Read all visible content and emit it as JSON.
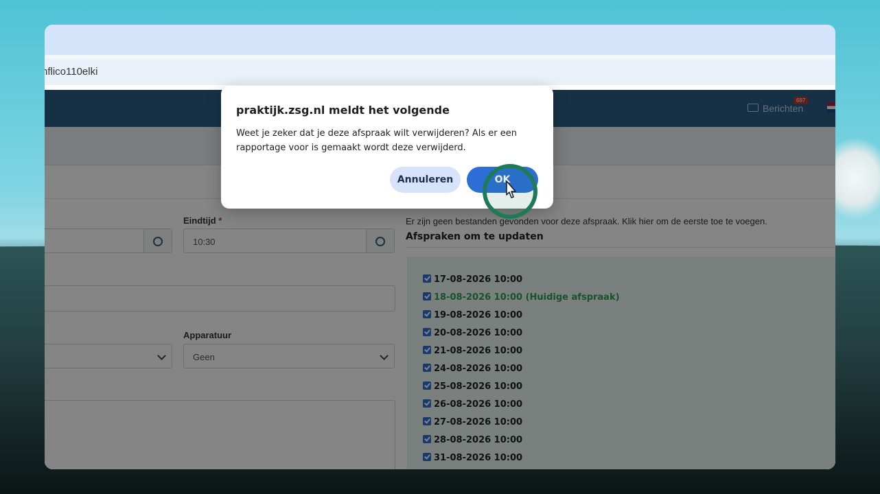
{
  "browser": {
    "url_fragment": "nflico110elki"
  },
  "navbar": {
    "messages_label": "Berichten",
    "messages_count": "697"
  },
  "form": {
    "end_time_label": "Eindtijd",
    "required_marker": "*",
    "end_time_value": "10:30",
    "equipment_label": "Apparatuur",
    "equipment_value": "Geen"
  },
  "files": {
    "empty_text": "Er zijn geen bestanden gevonden voor deze afspraak. Klik hier om de eerste toe te voegen."
  },
  "appointments": {
    "title": "Afspraken om te updaten",
    "items": [
      {
        "label": "17-08-2026 10:00",
        "checked": true,
        "current": false
      },
      {
        "label": "18-08-2026 10:00 (Huidige afspraak)",
        "checked": true,
        "current": true
      },
      {
        "label": "19-08-2026 10:00",
        "checked": true,
        "current": false
      },
      {
        "label": "20-08-2026 10:00",
        "checked": true,
        "current": false
      },
      {
        "label": "21-08-2026 10:00",
        "checked": true,
        "current": false
      },
      {
        "label": "24-08-2026 10:00",
        "checked": true,
        "current": false
      },
      {
        "label": "25-08-2026 10:00",
        "checked": true,
        "current": false
      },
      {
        "label": "26-08-2026 10:00",
        "checked": true,
        "current": false
      },
      {
        "label": "27-08-2026 10:00",
        "checked": true,
        "current": false
      },
      {
        "label": "28-08-2026 10:00",
        "checked": true,
        "current": false
      },
      {
        "label": "31-08-2026 10:00",
        "checked": true,
        "current": false
      }
    ]
  },
  "dialog": {
    "title": "praktijk.zsg.nl meldt het volgende",
    "message": "Weet je zeker dat je deze afspraak wilt verwijderen? Als er een rapportage voor is gemaakt wordt deze verwijderd.",
    "cancel_label": "Annuleren",
    "ok_label": "OK"
  },
  "colors": {
    "navbar": "#2b5f87",
    "ok_button": "#2c6ed6",
    "cancel_button": "#d6e3fa",
    "current_appointment": "#2e9e4f",
    "click_ring": "#1f7a5a"
  }
}
